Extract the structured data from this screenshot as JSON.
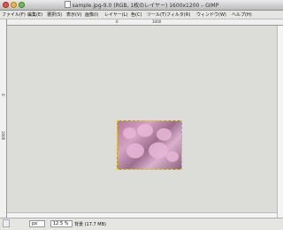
{
  "window": {
    "title": "sample.jpg-9.0 (RGB, 1枚のレイヤー) 1600x1200 – GIMP"
  },
  "menubar": {
    "items": [
      "ファイル(F)",
      "編集(E)",
      "選択(S)",
      "表示(V)",
      "画像(I)",
      "レイヤー(L)",
      "色(C)",
      "ツール(T)",
      "フィルタ(R)",
      "ウィンドウ(W)",
      "ヘルプ(H)"
    ]
  },
  "rulers": {
    "top_labels": [
      "0",
      "1000"
    ],
    "left_labels": [
      "0",
      "1000"
    ]
  },
  "statusbar": {
    "unit": "px",
    "zoom": "12.5 %",
    "status_text": "背景 (17.7 MB)"
  },
  "icons": {
    "document": "document-icon",
    "close": "close-traffic-icon",
    "minimize": "minimize-traffic-icon",
    "maximize": "maximize-traffic-icon"
  }
}
